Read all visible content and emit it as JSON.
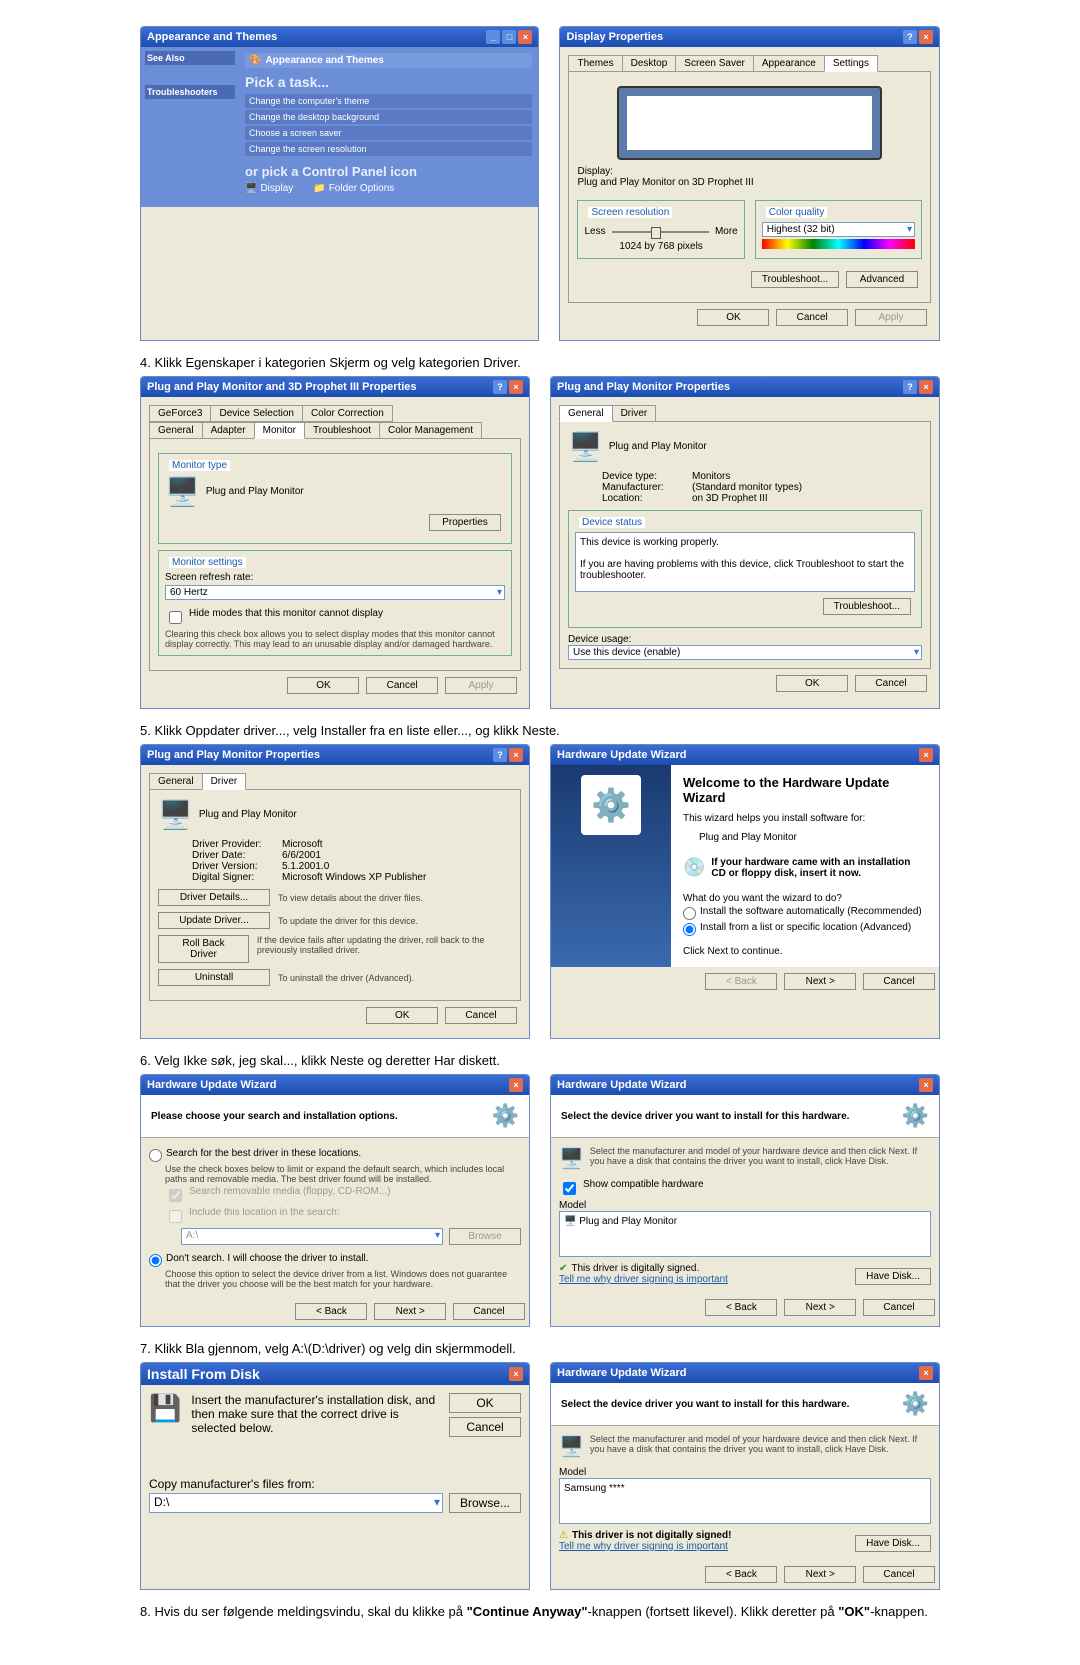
{
  "steps": {
    "s4": "4.  Klikk Egenskaper i kategorien Skjerm og velg kategorien Driver.",
    "s5": "5.  Klikk Oppdater driver..., velg Installer fra en liste eller..., og klikk Neste.",
    "s6": "6.  Velg Ikke søk, jeg skal..., klikk Neste og deretter Har diskett.",
    "s7": "7.  Klikk Bla gjennom, velg A:\\(D:\\driver) og velg din skjermmodell.",
    "s8a": "8.  Hvis du ser følgende meldingsvindu, skal du klikke på ",
    "s8b": "-knappen (fortsett likevel). Klikk deretter på ",
    "s8c": "-knappen.",
    "s8_btn1": "\"Continue Anyway\"",
    "s8_btn2": "\"OK\""
  },
  "cp": {
    "title": "Appearance and Themes",
    "heading": "Appearance and Themes",
    "pick_task": "Pick a task...",
    "t1": "Change the computer's theme",
    "t2": "Change the desktop background",
    "t3": "Choose a screen saver",
    "t4": "Change the screen resolution",
    "or_pick": "or pick a Control Panel icon",
    "icon1": "Display",
    "icon2": "Folder Options",
    "see_also": "See Also",
    "trouble": "Troubleshooters"
  },
  "disp": {
    "title": "Display Properties",
    "tabs": {
      "themes": "Themes",
      "desktop": "Desktop",
      "ss": "Screen Saver",
      "appearance": "Appearance",
      "settings": "Settings"
    },
    "display_label": "Display:",
    "display_value": "Plug and Play Monitor on 3D Prophet III",
    "res_legend": "Screen resolution",
    "less": "Less",
    "more": "More",
    "res_value": "1024 by 768 pixels",
    "cq_legend": "Color quality",
    "cq_value": "Highest (32 bit)",
    "troubleshoot": "Troubleshoot...",
    "advanced": "Advanced",
    "ok": "OK",
    "cancel": "Cancel",
    "apply": "Apply"
  },
  "adv": {
    "title": "Plug and Play Monitor and 3D Prophet III Properties",
    "tabs": {
      "gf": "GeForce3",
      "ds": "Device Selection",
      "cc": "Color Correction",
      "gen": "General",
      "ad": "Adapter",
      "mon": "Monitor",
      "ts": "Troubleshoot",
      "cm": "Color Management"
    },
    "mt_legend": "Monitor type",
    "mt_value": "Plug and Play Monitor",
    "properties": "Properties",
    "ms_legend": "Monitor settings",
    "refresh_label": "Screen refresh rate:",
    "refresh_value": "60 Hertz",
    "hide": "Hide modes that this monitor cannot display",
    "hide_desc": "Clearing this check box allows you to select display modes that this monitor cannot display correctly. This may lead to an unusable display and/or damaged hardware.",
    "ok": "OK",
    "cancel": "Cancel",
    "apply": "Apply"
  },
  "monprop": {
    "title": "Plug and Play Monitor Properties",
    "tabs": {
      "gen": "General",
      "drv": "Driver"
    },
    "name": "Plug and Play Monitor",
    "dt_label": "Device type:",
    "dt_value": "Monitors",
    "mf_label": "Manufacturer:",
    "mf_value": "(Standard monitor types)",
    "loc_label": "Location:",
    "loc_value": "on 3D Prophet III",
    "status_legend": "Device status",
    "status_line": "This device is working properly.",
    "status_help": "If you are having problems with this device, click Troubleshoot to start the troubleshooter.",
    "troubleshoot": "Troubleshoot...",
    "usage_label": "Device usage:",
    "usage_value": "Use this device (enable)",
    "ok": "OK",
    "cancel": "Cancel"
  },
  "drvtab": {
    "title": "Plug and Play Monitor Properties",
    "name": "Plug and Play Monitor",
    "dp_label": "Driver Provider:",
    "dp_value": "Microsoft",
    "dd_label": "Driver Date:",
    "dd_value": "6/6/2001",
    "dv_label": "Driver Version:",
    "dv_value": "5.1.2001.0",
    "ds_label": "Digital Signer:",
    "ds_value": "Microsoft Windows XP Publisher",
    "details_btn": "Driver Details...",
    "details_desc": "To view details about the driver files.",
    "update_btn": "Update Driver...",
    "update_desc": "To update the driver for this device.",
    "rollback_btn": "Roll Back Driver",
    "rollback_desc": "If the device fails after updating the driver, roll back to the previously installed driver.",
    "uninstall_btn": "Uninstall",
    "uninstall_desc": "To uninstall the driver (Advanced).",
    "ok": "OK",
    "cancel": "Cancel"
  },
  "wiz1": {
    "title": "Hardware Update Wizard",
    "welcome": "Welcome to the Hardware Update Wizard",
    "helps": "This wizard helps you install software for:",
    "device": "Plug and Play Monitor",
    "cd_tip": "If your hardware came with an installation CD or floppy disk, insert it now.",
    "q": "What do you want the wizard to do?",
    "opt1": "Install the software automatically (Recommended)",
    "opt2": "Install from a list or specific location (Advanced)",
    "cont": "Click Next to continue.",
    "back": "< Back",
    "next": "Next >",
    "cancel": "Cancel"
  },
  "wiz2": {
    "title": "Hardware Update Wizard",
    "heading": "Please choose your search and installation options.",
    "opt1": "Search for the best driver in these locations.",
    "opt1_desc": "Use the check boxes below to limit or expand the default search, which includes local paths and removable media. The best driver found will be installed.",
    "chk1": "Search removable media (floppy, CD-ROM...)",
    "chk2": "Include this location in the search:",
    "path": "A:\\",
    "browse": "Browse",
    "opt2": "Don't search. I will choose the driver to install.",
    "opt2_desc": "Choose this option to select the device driver from a list. Windows does not guarantee that the driver you choose will be the best match for your hardware.",
    "back": "< Back",
    "next": "Next >",
    "cancel": "Cancel"
  },
  "wiz3": {
    "title": "Hardware Update Wizard",
    "heading": "Select the device driver you want to install for this hardware.",
    "desc": "Select the manufacturer and model of your hardware device and then click Next. If you have a disk that contains the driver you want to install, click Have Disk.",
    "chk": "Show compatible hardware",
    "model_label": "Model",
    "model": "Plug and Play Monitor",
    "signed": "This driver is digitally signed.",
    "tell": "Tell me why driver signing is important",
    "havedisk": "Have Disk...",
    "back": "< Back",
    "next": "Next >",
    "cancel": "Cancel"
  },
  "ifd": {
    "title": "Install From Disk",
    "desc": "Insert the manufacturer's installation disk, and then make sure that the correct drive is selected below.",
    "ok": "OK",
    "cancel": "Cancel",
    "copy_label": "Copy manufacturer's files from:",
    "path": "D:\\",
    "browse": "Browse..."
  },
  "wiz4": {
    "title": "Hardware Update Wizard",
    "heading": "Select the device driver you want to install for this hardware.",
    "desc": "Select the manufacturer and model of your hardware device and then click Next. If you have a disk that contains the driver you want to install, click Have Disk.",
    "model_label": "Model",
    "model": "Samsung ****",
    "warn": "This driver is not digitally signed!",
    "tell": "Tell me why driver signing is important",
    "havedisk": "Have Disk...",
    "back": "< Back",
    "next": "Next >",
    "cancel": "Cancel"
  }
}
